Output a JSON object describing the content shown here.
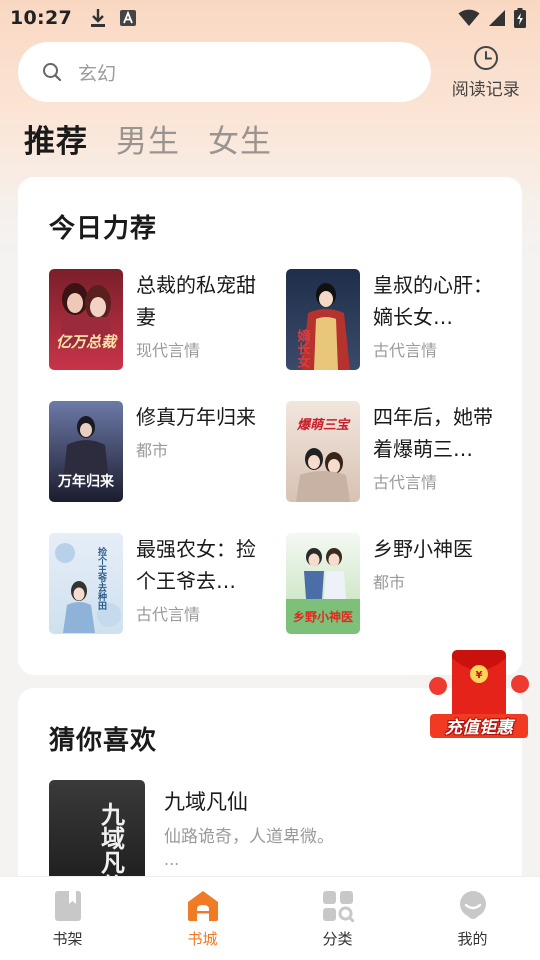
{
  "status_bar": {
    "time": "10:27"
  },
  "search": {
    "placeholder": "玄幻"
  },
  "history": {
    "label": "阅读记录"
  },
  "tabs": [
    {
      "label": "推荐",
      "active": true
    },
    {
      "label": "男生",
      "active": false
    },
    {
      "label": "女生",
      "active": false
    }
  ],
  "recommend": {
    "title": "今日力荐",
    "books": [
      {
        "title": "总裁的私宠甜妻",
        "genre": "现代言情",
        "cover_text": "亿万总裁"
      },
      {
        "title": "皇叔的心肝：嫡长女…",
        "genre": "古代言情",
        "cover_text": "嫡长女"
      },
      {
        "title": "修真万年归来",
        "genre": "都市",
        "cover_text": "万年归来"
      },
      {
        "title": "四年后，她带着爆萌三…",
        "genre": "古代言情",
        "cover_text": "爆萌三宝"
      },
      {
        "title": "最强农女：捡个王爷去…",
        "genre": "古代言情",
        "cover_text": "捡个王爷去种田"
      },
      {
        "title": "乡野小神医",
        "genre": "都市",
        "cover_text": "乡野小神医"
      }
    ]
  },
  "guess": {
    "title": "猜你喜欢",
    "book": {
      "title": "九域凡仙",
      "desc": "仙路诡奇，人道卑微。",
      "more": "...",
      "cover_text": "九域凡仙"
    }
  },
  "promo": {
    "label": "充值钜惠"
  },
  "bottom_nav": [
    {
      "label": "书架",
      "icon": "bookshelf-icon",
      "active": false
    },
    {
      "label": "书城",
      "icon": "bookstore-icon",
      "active": true
    },
    {
      "label": "分类",
      "icon": "category-icon",
      "active": false
    },
    {
      "label": "我的",
      "icon": "profile-icon",
      "active": false
    }
  ],
  "colors": {
    "accent": "#f07b26",
    "inactive_icon": "#c8c8c8"
  }
}
